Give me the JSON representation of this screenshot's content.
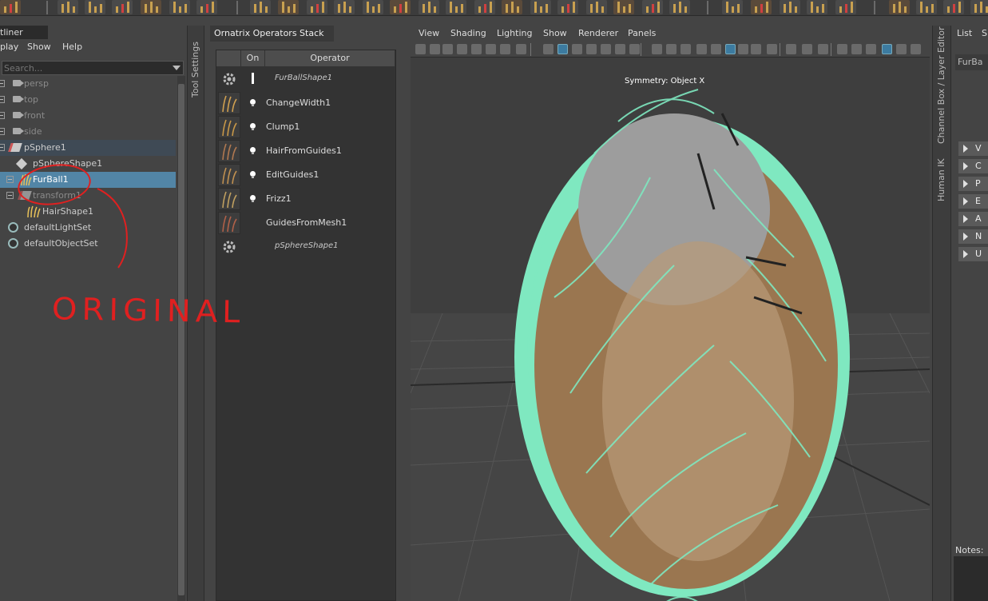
{
  "outliner": {
    "title": "tliner",
    "menu": [
      "play",
      "Show",
      "Help"
    ],
    "search_placeholder": "Search...",
    "tree": [
      {
        "label": "persp",
        "kind": "camera"
      },
      {
        "label": "top",
        "kind": "camera"
      },
      {
        "label": "front",
        "kind": "camera"
      },
      {
        "label": "side",
        "kind": "camera"
      },
      {
        "label": "pSphere1",
        "kind": "mesh"
      },
      {
        "label": "pSphereShape1",
        "kind": "shape"
      },
      {
        "label": "FurBall1",
        "kind": "fur"
      },
      {
        "label": "transform1",
        "kind": "mesh"
      },
      {
        "label": "HairShape1",
        "kind": "hair"
      },
      {
        "label": "defaultLightSet",
        "kind": "set"
      },
      {
        "label": "defaultObjectSet",
        "kind": "set"
      }
    ]
  },
  "tool_settings": {
    "label": "Tool Settings"
  },
  "ornatrix": {
    "title": "Ornatrix Operators Stack",
    "col_on": "On",
    "col_operator": "Operator",
    "operators": [
      {
        "name": "FurBallShape1",
        "italic": true,
        "icon": "gear-icon"
      },
      {
        "name": "ChangeWidth1",
        "italic": false,
        "icon": "change-width-icon"
      },
      {
        "name": "Clump1",
        "italic": false,
        "icon": "clump-icon"
      },
      {
        "name": "HairFromGuides1",
        "italic": false,
        "icon": "hair-from-guides-icon"
      },
      {
        "name": "EditGuides1",
        "italic": false,
        "icon": "edit-guides-icon"
      },
      {
        "name": "Frizz1",
        "italic": false,
        "icon": "frizz-icon"
      },
      {
        "name": "GuidesFromMesh1",
        "italic": false,
        "icon": "guides-from-mesh-icon"
      },
      {
        "name": "pSphereShape1",
        "italic": true,
        "icon": "gear-icon"
      }
    ]
  },
  "viewport": {
    "menu": [
      "View",
      "Shading",
      "Lighting",
      "Show",
      "Renderer",
      "Panels"
    ],
    "hud_text": "Symmetry: Object X"
  },
  "right_strip": {
    "labels": [
      "Channel Box / Layer Editor",
      "Human IK"
    ]
  },
  "channel_box": {
    "menu": [
      "List",
      "S"
    ],
    "object_name": "FurBa",
    "sections": [
      "V",
      "C",
      "P",
      "E",
      "A",
      "N",
      "U"
    ],
    "notes_label": "Notes:"
  },
  "annotation": {
    "text": "ORIGINAL",
    "color": "#e02020"
  },
  "colors": {
    "selected": "#5285a6",
    "hair": "#7fe8c0",
    "fur_body": "#a07a52"
  }
}
